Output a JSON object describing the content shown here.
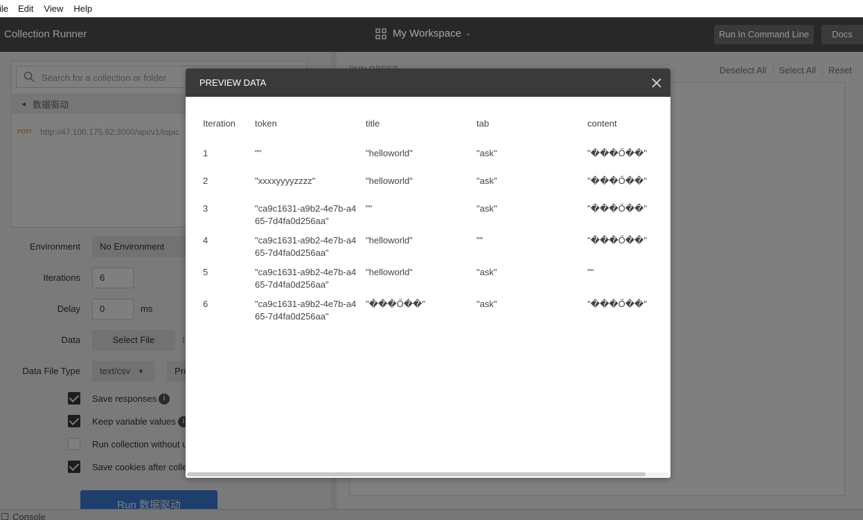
{
  "menu": [
    "ile",
    "Edit",
    "View",
    "Help"
  ],
  "header": {
    "app_title": "Collection Runner",
    "workspace": "My Workspace",
    "run_cmd_label": "Run In Command Line",
    "docs_label": "Docs"
  },
  "left": {
    "search_placeholder": "Search for a collection or folder",
    "collection_name": "数据驱动",
    "request_method": "POST",
    "request_url": "http://47.100.175.62:3000/api/v1/topic",
    "environment_label": "Environment",
    "environment_value": "No Environment",
    "iterations_label": "Iterations",
    "iterations_value": "6",
    "delay_label": "Delay",
    "delay_value": "0",
    "delay_unit": "ms",
    "data_label": "Data",
    "select_file_label": "Select File",
    "select_file_suffix": "t",
    "data_file_type_label": "Data File Type",
    "data_file_type_value": "text/csv",
    "preview_button_partial": "Pre",
    "save_responses": "Save responses",
    "keep_variable_values": "Keep variable values",
    "run_without": "Run collection without u",
    "save_cookies": "Save cookies after collec",
    "run_button": "Run 数据驱动"
  },
  "right": {
    "run_order": "RUN ORDER",
    "deselect_all": "Deselect All",
    "select_all": "Select All",
    "reset": "Reset"
  },
  "console": {
    "label": "Console"
  },
  "modal": {
    "title": "PREVIEW DATA",
    "columns": [
      "Iteration",
      "token",
      "title",
      "tab",
      "content"
    ],
    "rows": [
      [
        "1",
        "\"\"",
        "\"helloworld\"",
        "\"ask\"",
        "\"���Ő��\""
      ],
      [
        "2",
        "\"xxxxyyyyzzzz\"",
        "\"helloworld\"",
        "\"ask\"",
        "\"���Ő��\""
      ],
      [
        "3",
        "\"ca9c1631-a9b2-4e7b-a465-7d4fa0d256aa\"",
        "\"\"",
        "\"ask\"",
        "\"���Ő��\""
      ],
      [
        "4",
        "\"ca9c1631-a9b2-4e7b-a465-7d4fa0d256aa\"",
        "\"helloworld\"",
        "\"\"",
        "\"���Ő��\""
      ],
      [
        "5",
        "\"ca9c1631-a9b2-4e7b-a465-7d4fa0d256aa\"",
        "\"helloworld\"",
        "\"ask\"",
        "\"\""
      ],
      [
        "6",
        "\"ca9c1631-a9b2-4e7b-a465-7d4fa0d256aa\"",
        "\"���Ő��\"",
        "\"ask\"",
        "\"���Ő��\""
      ]
    ]
  },
  "colors": {
    "header_bg": "#282828",
    "modal_header_bg": "#3a3a3a",
    "run_button": "#3d7cd8"
  },
  "icons": [
    "grid-icon",
    "chevron-down-icon",
    "search-icon",
    "triangle-left-icon",
    "info-icon",
    "close-icon",
    "checkbox-icon",
    "console-icon"
  ]
}
